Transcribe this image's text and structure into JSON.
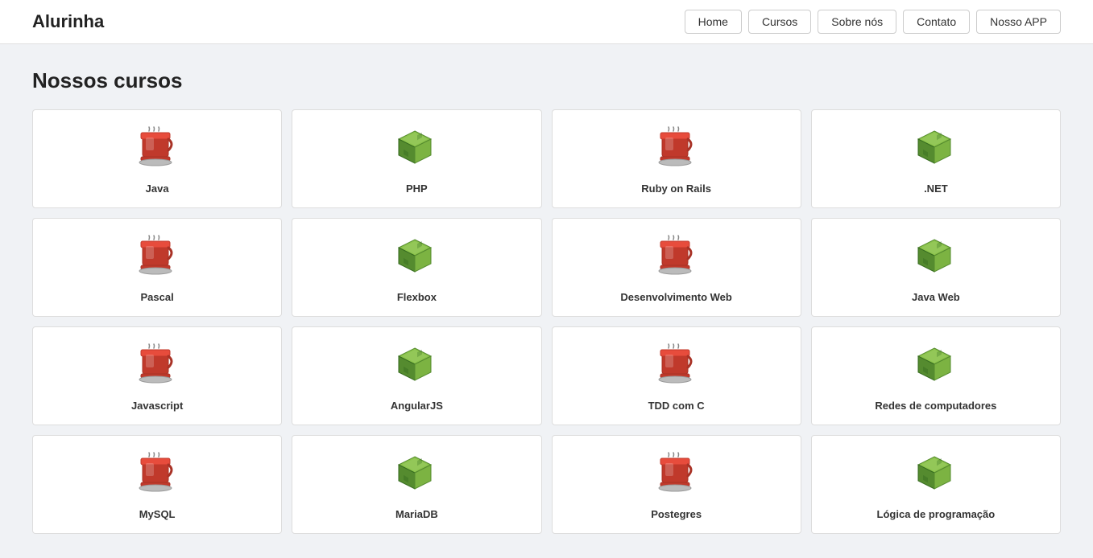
{
  "header": {
    "logo": "Alurinha",
    "nav": [
      {
        "label": "Home",
        "id": "nav-home"
      },
      {
        "label": "Cursos",
        "id": "nav-cursos"
      },
      {
        "label": "Sobre nós",
        "id": "nav-sobre"
      },
      {
        "label": "Contato",
        "id": "nav-contato"
      },
      {
        "label": "Nosso APP",
        "id": "nav-app"
      }
    ]
  },
  "main": {
    "section_title": "Nossos cursos",
    "courses": [
      {
        "id": "java",
        "label": "Java",
        "icon": "coffee"
      },
      {
        "id": "php",
        "label": "PHP",
        "icon": "block"
      },
      {
        "id": "ruby-on-rails",
        "label": "Ruby on Rails",
        "icon": "coffee"
      },
      {
        "id": "net",
        "label": ".NET",
        "icon": "block"
      },
      {
        "id": "pascal",
        "label": "Pascal",
        "icon": "coffee"
      },
      {
        "id": "flexbox",
        "label": "Flexbox",
        "icon": "block"
      },
      {
        "id": "desenvolvimento-web",
        "label": "Desenvolvimento Web",
        "icon": "coffee"
      },
      {
        "id": "java-web",
        "label": "Java Web",
        "icon": "block"
      },
      {
        "id": "javascript",
        "label": "Javascript",
        "icon": "coffee"
      },
      {
        "id": "angularjs",
        "label": "AngularJS",
        "icon": "block"
      },
      {
        "id": "tdd-com-c",
        "label": "TDD com C",
        "icon": "coffee"
      },
      {
        "id": "redes-de-computadores",
        "label": "Redes de computadores",
        "icon": "block"
      },
      {
        "id": "mysql",
        "label": "MySQL",
        "icon": "coffee"
      },
      {
        "id": "mariadb",
        "label": "MariaDB",
        "icon": "block"
      },
      {
        "id": "postegres",
        "label": "Postegres",
        "icon": "coffee"
      },
      {
        "id": "logica-de-programacao",
        "label": "Lógica de programação",
        "icon": "block"
      }
    ]
  }
}
